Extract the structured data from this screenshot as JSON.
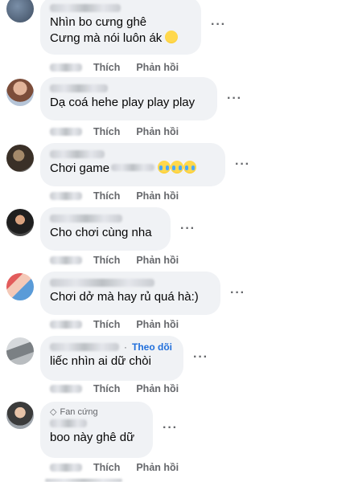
{
  "comments": [
    {
      "text_lines": [
        "Nhìn bo cưng ghê",
        "Cưng mà nói luôn ák"
      ],
      "emoji": "hugging-face"
    },
    {
      "text_lines": [
        "Dạ coá hehe play play play"
      ]
    },
    {
      "text_prefix": "Chơi game",
      "emoji": "tears-of-joy x3"
    },
    {
      "text_lines": [
        "Cho chơi cùng nha"
      ]
    },
    {
      "text_lines": [
        "Chơi dở mà hay rủ quá hà:)"
      ]
    },
    {
      "follow_label": "Theo dõi",
      "separator": "·",
      "text_lines": [
        "liếc nhìn ai dữ chòi"
      ]
    },
    {
      "badge_label": "Fan cứng",
      "text_lines": [
        "boo này ghê dữ"
      ]
    }
  ],
  "actions": {
    "like": "Thích",
    "reply": "Phản hồi"
  },
  "more_glyph": "···"
}
